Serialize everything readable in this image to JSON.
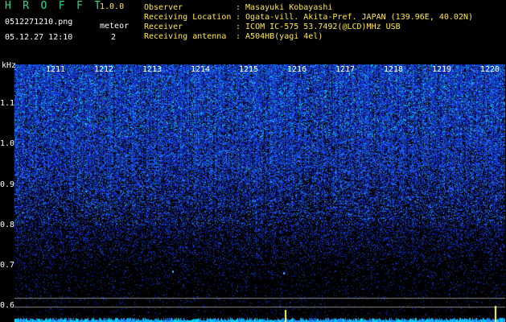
{
  "header": {
    "app_title": "H R O F F T",
    "app_version": "1.0.0",
    "file_name": "0512271210.png",
    "timestamp": "05.12.27 12:10",
    "meteor_label": "meteor",
    "meteor_count": "2"
  },
  "info": [
    {
      "label": "Observer",
      "value": ": Masayuki Kobayashi"
    },
    {
      "label": "Receiving Location",
      "value": ": Ogata-vill. Akita-Pref. JAPAN (139.96E, 40.02N)"
    },
    {
      "label": "Receiver",
      "value": ": ICOM IC-575 53.7492(@LCD)MHz USB"
    },
    {
      "label": "Receiving antenna",
      "value": ": A504HB(yagi 4el)"
    }
  ],
  "spectrogram": {
    "unit": "kHz",
    "y_ticks": [
      "1.1",
      "1.0",
      "0.9",
      "0.8",
      "0.7",
      "0.6"
    ],
    "x_ticks": [
      "1211",
      "1212",
      "1213",
      "1214",
      "1215",
      "1216",
      "1217",
      "1218",
      "1219",
      "1220"
    ],
    "colors": {
      "background": "#000000",
      "signal": "#1e3cff",
      "bright": "#00e6ff",
      "marker": "#ffff66",
      "reference_line": "#8a8a8a"
    }
  }
}
